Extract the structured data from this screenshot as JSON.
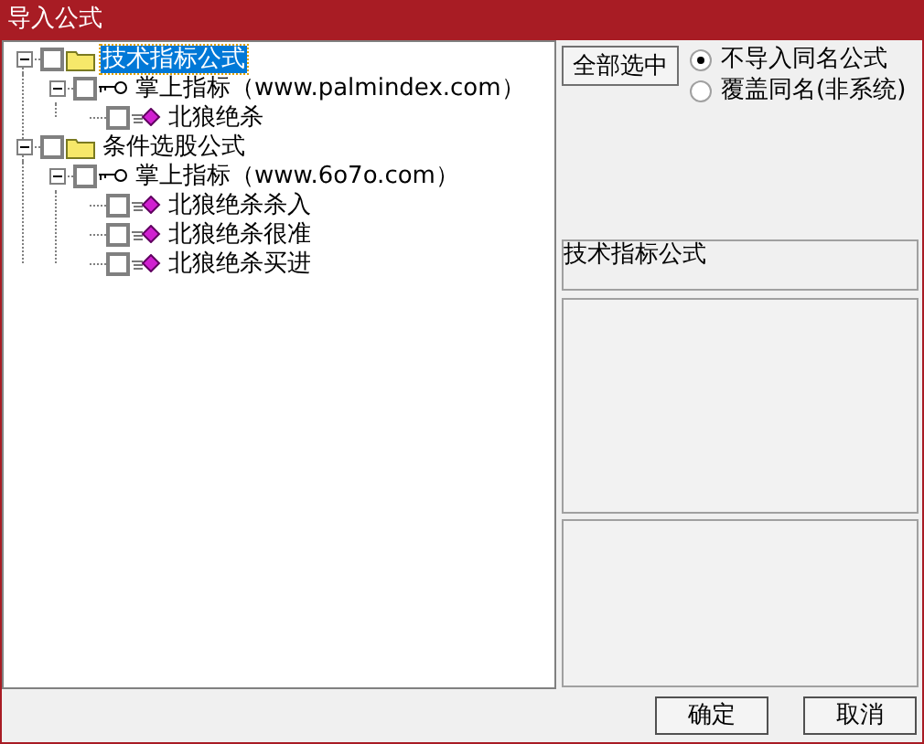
{
  "window": {
    "title": "导入公式"
  },
  "tree": [
    {
      "kind": "folder",
      "label": "技术指标公式",
      "checked": false,
      "expanded": true,
      "selected": true,
      "children": [
        {
          "kind": "group",
          "label": "掌上指标（www.palmindex.com）",
          "checked": false,
          "expanded": true,
          "selected": false,
          "children": [
            {
              "kind": "formula",
              "label": "北狼绝杀",
              "checked": false,
              "selected": false
            }
          ]
        }
      ]
    },
    {
      "kind": "folder",
      "label": "条件选股公式",
      "checked": false,
      "expanded": true,
      "selected": false,
      "children": [
        {
          "kind": "group",
          "label": "掌上指标（www.6o7o.com）",
          "checked": false,
          "expanded": true,
          "selected": false,
          "children": [
            {
              "kind": "formula",
              "label": "北狼绝杀杀入",
              "checked": false,
              "selected": false
            },
            {
              "kind": "formula",
              "label": "北狼绝杀很准",
              "checked": false,
              "selected": false
            },
            {
              "kind": "formula",
              "label": "北狼绝杀买进",
              "checked": false,
              "selected": false
            }
          ]
        }
      ]
    }
  ],
  "select_all_button": "全部选中",
  "radio_options": [
    {
      "label": "不导入同名公式",
      "selected": true
    },
    {
      "label": "覆盖同名(非系统)",
      "selected": false
    }
  ],
  "info_box": "技术指标公式",
  "buttons": [
    "确定",
    "取消"
  ]
}
